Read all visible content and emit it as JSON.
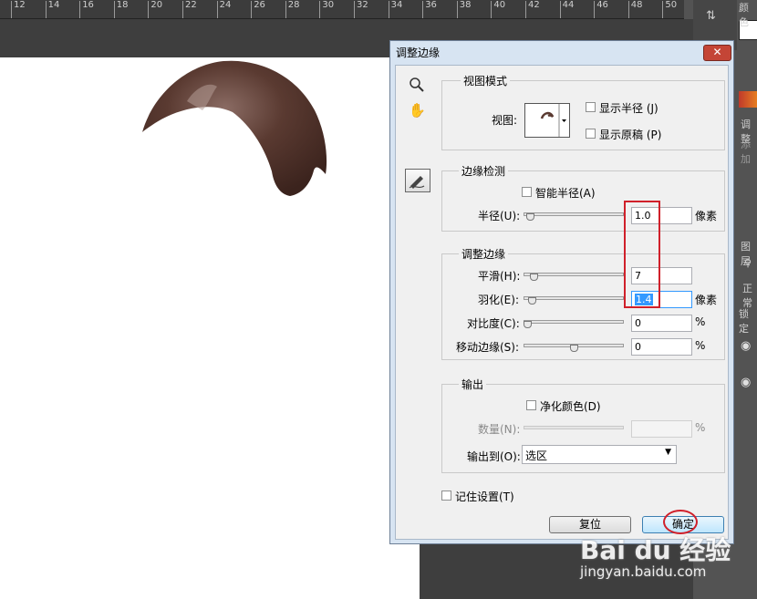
{
  "ruler": {
    "ticks": [
      "12",
      "14",
      "16",
      "18",
      "20",
      "22",
      "24",
      "26",
      "28",
      "30",
      "32",
      "34",
      "36",
      "38",
      "40",
      "42",
      "44",
      "46",
      "48",
      "50"
    ]
  },
  "right_panel": {
    "tab_color": "颜色",
    "adjust_label": "调整",
    "add_label": "添加",
    "layers_label": "图层",
    "normal_label": "正常",
    "lock_label": "锁定"
  },
  "dialog": {
    "title": "调整边缘",
    "close": "✕",
    "view_mode": {
      "group_title": "视图模式",
      "view_label": "视图:",
      "show_radius": "显示半径 (J)",
      "show_original": "显示原稿 (P)"
    },
    "edge_detection": {
      "group_title": "边缘检测",
      "smart_radius": "智能半径(A)",
      "radius_label": "半径(U):",
      "radius_value": "1.0",
      "radius_unit": "像素",
      "radius_level": 0.03
    },
    "adjust_edge": {
      "group_title": "调整边缘",
      "smooth_label": "平滑(H):",
      "smooth_value": "7",
      "smooth_level": 0.07,
      "feather_label": "羽化(E):",
      "feather_value": "1.4",
      "feather_unit": "像素",
      "feather_level": 0.05,
      "contrast_label": "对比度(C):",
      "contrast_value": "0",
      "contrast_unit": "%",
      "contrast_level": 0,
      "shift_label": "移动边缘(S):",
      "shift_value": "0",
      "shift_unit": "%",
      "shift_level": 0.5
    },
    "output": {
      "group_title": "输出",
      "decontaminate": "净化颜色(D)",
      "amount_label": "数量(N):",
      "amount_unit": "%",
      "output_to_label": "输出到(O):",
      "output_to_value": "选区"
    },
    "remember": "记住设置(T)",
    "reset_button": "复位",
    "ok_button": "确定"
  },
  "watermark": {
    "line1": "Bai du 经验",
    "line2": "jingyan.baidu.com"
  },
  "colors": {
    "highlight": "#d0202a",
    "selection": "#3399ff"
  }
}
